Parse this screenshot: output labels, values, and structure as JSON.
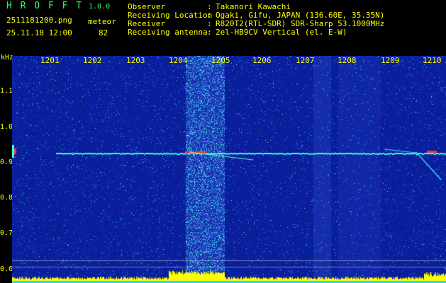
{
  "app": {
    "title": "H R O F F T",
    "version": "1.0.0",
    "filename": "2511181200.png",
    "datetime": "25.11.18 12:00",
    "category": "meteor",
    "count": "82"
  },
  "info": [
    {
      "key": "Observer",
      "value": "Takanori Kawachi"
    },
    {
      "key": "Receiving Location",
      "value": "Ogaki, Gifu, JAPAN (136.60E, 35.35N)"
    },
    {
      "key": "Receiver",
      "value": "R820T2(RTL-SDR) SDR-Sharp 53.1000MHz"
    },
    {
      "key": "Receiving antenna",
      "value": "2el-HB9CV Vertical (el. E-W)"
    }
  ],
  "axis": {
    "y_unit": "kHz",
    "y_ticks": [
      "1.1",
      "1.0",
      "0.9",
      "0.8",
      "0.7",
      "0.6"
    ],
    "x_ticks": [
      "1201",
      "1202",
      "1203",
      "1204",
      "1205",
      "1206",
      "1207",
      "1208",
      "1209",
      "1210"
    ]
  },
  "colors": {
    "background": "#000000",
    "label_yellow": "#ffff00",
    "title_green": "#33ff66",
    "spectrogram_base": "#0a1e9a",
    "trace_cyan": "#40ffe0",
    "hot_red": "#ff3030",
    "bottom_bar": "#ffff00"
  }
}
